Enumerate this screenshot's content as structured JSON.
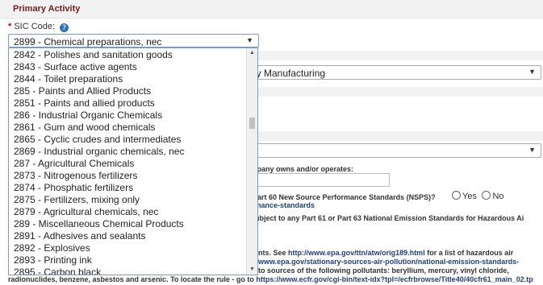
{
  "section": {
    "title": "Primary Activity"
  },
  "sic": {
    "required_mark": "*",
    "label": "SIC Code:",
    "help_icon": "?",
    "selected_value": "2899 - Chemical preparations, nec",
    "options": [
      "2842 - Polishes and sanitation goods",
      "2843 - Surface active agents",
      "2844 - Toilet preparations",
      "285 - Paints and Allied Products",
      "2851 - Paints and allied products",
      "286 - Industrial Organic Chemicals",
      "2861 - Gum and wood chemicals",
      "2865 - Cyclic crudes and intermediates",
      "2869 - Industrial organic chemicals, nec",
      "287 - Agricultural Chemicals",
      "2873 - Nitrogenous fertilizers",
      "2874 - Phosphatic fertilizers",
      "2875 - Fertilizers, mixing only",
      "2879 - Agricultural chemicals, nec",
      "289 - Miscellaneous Chemical Products",
      "2891 - Adhesives and sealants",
      "2892 - Explosives",
      "2893 - Printing ink",
      "2895 - Carbon black",
      "2899 - Chemical preparations, nec"
    ]
  },
  "naics": {
    "value": "ery Manufacturing"
  },
  "background": {
    "owns_text": "company owns and/or operates:",
    "nsps_text": "ny Part 60 New Source Performance Standards (NSPS)?",
    "nsps_link": "rformance-standards",
    "yes_label": "Yes",
    "no_label": "No",
    "neshap_text": "re subject to any Part 61 or Part 63 National Emission Standards for Hazardous Ai",
    "hazard_prefix": "nts. See ",
    "hazard_link": "http://www.epa.gov/ttn/atw/orig189.html",
    "hazard_suffix": " for a list of hazardous air",
    "line2_link": "www.epa.gov/stationary-sources-air-pollution/national-emission-standards-",
    "line3_text": " to sources of the following pollutants: beryllium, mercury, vinyl chloride,",
    "line4_prefix": "radionuclides, benzene, asbestos and arsenic. To locate the rule - go to ",
    "line4_link": "https://www.ecfr.gov/cgi-bin/text-idx?tpl=/ecfrbrowse/Title40/40cfr61_main_02.tp"
  }
}
